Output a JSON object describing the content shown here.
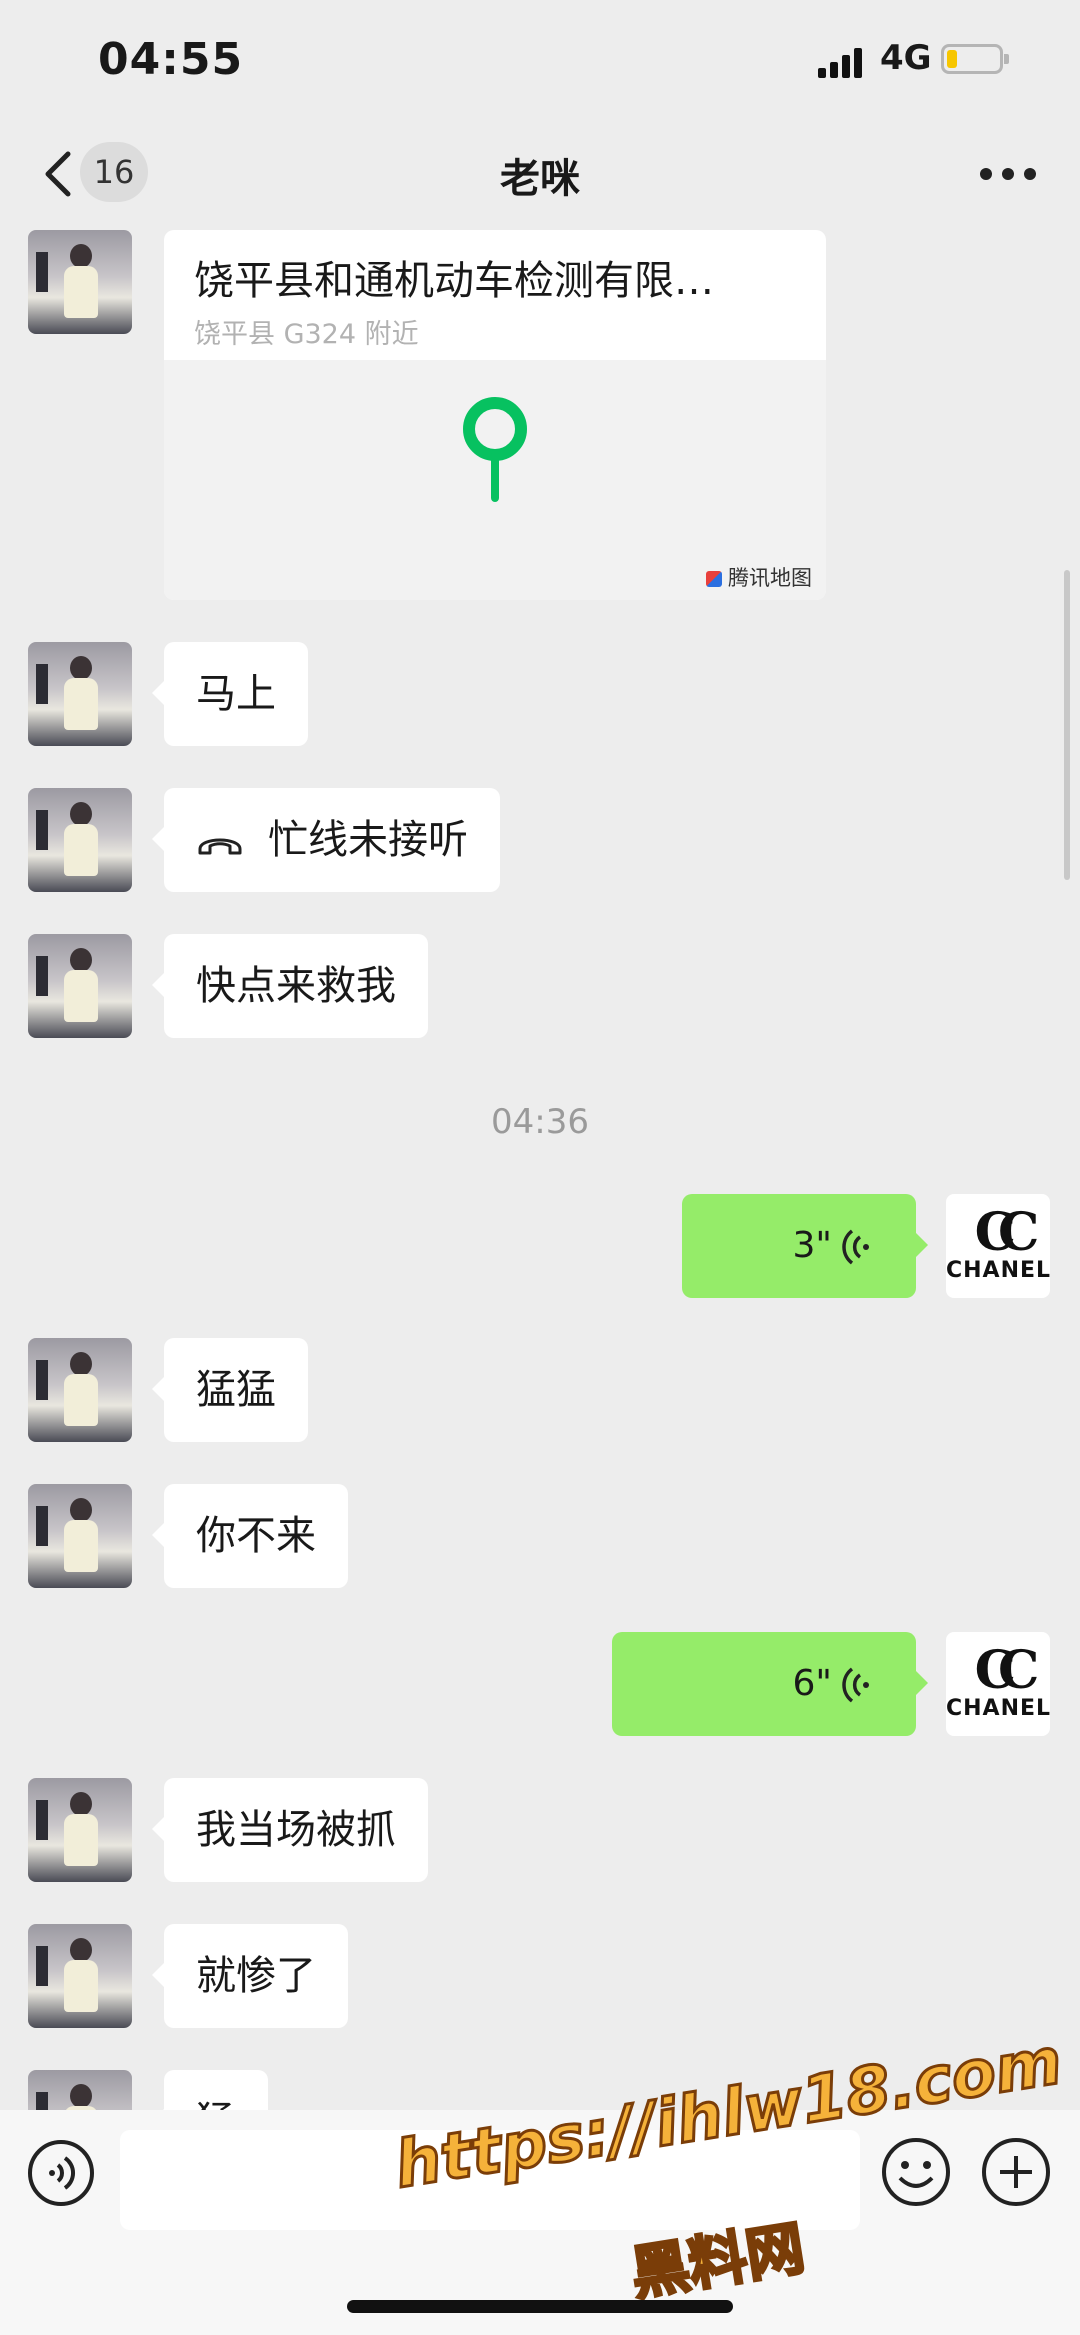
{
  "status_bar": {
    "time": "04:55",
    "network": "4G",
    "battery_level": 0.2
  },
  "header": {
    "unread_count": "16",
    "title": "老咪"
  },
  "messages": {
    "location": {
      "title": "饶平县和通机动车检测有限…",
      "address": "饶平县 G324 附近",
      "map_brand": "腾讯地图"
    },
    "m1": "马上",
    "m2_call": "忙线未接听",
    "m3": "快点来救我",
    "timestamp": "04:36",
    "voice1": "3\"",
    "m4": "猛猛",
    "m5": "你不来",
    "voice2": "6\"",
    "m6": "我当场被抓",
    "m7": "就惨了",
    "m8_partial": "猛"
  },
  "self_avatar": {
    "logo_mark": "CC",
    "logo_text": "CHANEL"
  },
  "input_bar": {
    "placeholder": ""
  },
  "watermark": {
    "url": "https://ihlw18.com",
    "name": "黑料网"
  },
  "colors": {
    "sent_bubble": "#95ec69",
    "received_bubble": "#ffffff",
    "background": "#ededed",
    "pin": "#07c160",
    "watermark": "#f5b23a"
  }
}
